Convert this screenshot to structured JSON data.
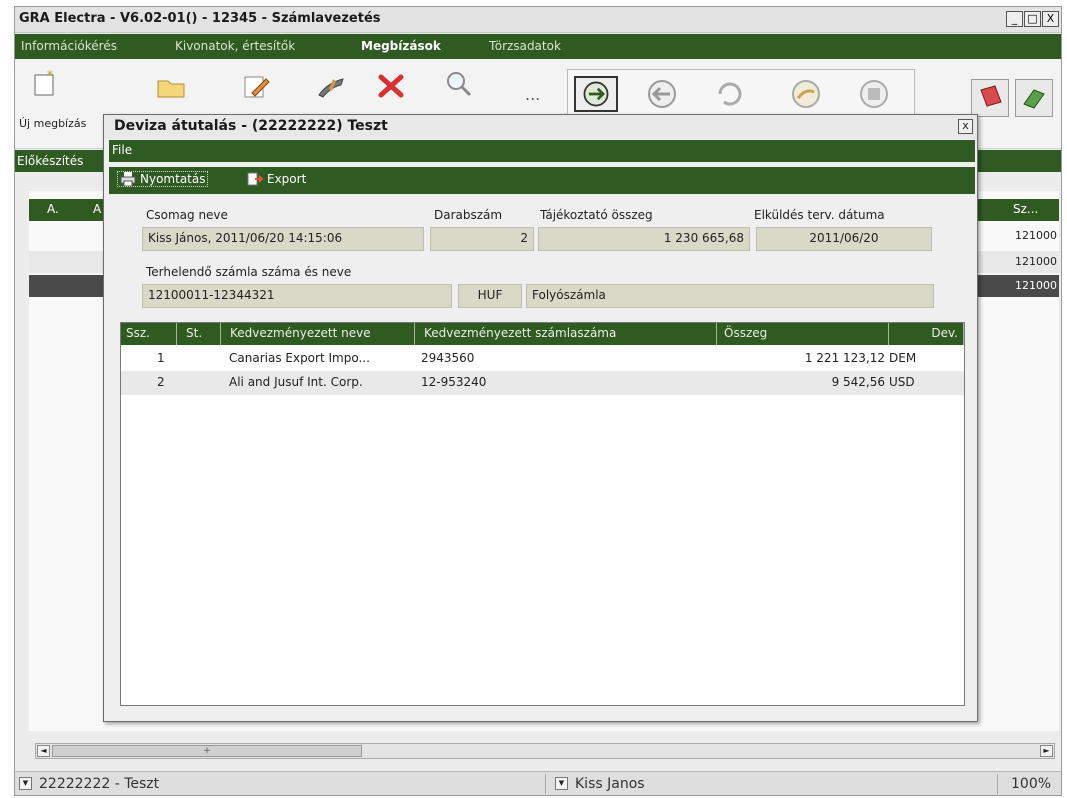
{
  "window": {
    "title": "GRA Electra - V6.02-01() - 12345 - Számlavezetés",
    "controls": [
      "_",
      "□",
      "X"
    ]
  },
  "menu": {
    "items": [
      "Információkérés",
      "Kivonatok, értesítők",
      "Megbízások",
      "Törzsadatok"
    ],
    "active": "Megbízások"
  },
  "toolbar": {
    "new_order_label": "Új megbízás",
    "icons": [
      "new-document-icon",
      "folder-icon",
      "edit-icon",
      "sign-icon",
      "delete-icon",
      "search-icon",
      "more-icon"
    ],
    "more_label": "...",
    "group_icons": [
      "send-icon",
      "retrieve-icon",
      "refresh-icon",
      "status-icon",
      "archive-icon"
    ]
  },
  "status_strip": {
    "label": "Előkészítés"
  },
  "background_grid": {
    "headers": [
      "A.",
      "A",
      "Sz..."
    ],
    "cells": [
      "121000",
      "121000",
      "121000"
    ]
  },
  "dialog": {
    "title": "Deviza átutalás  - (22222222) Teszt",
    "close": "x",
    "menu_file": "File",
    "print_label": "Nyomtatás",
    "export_label": "Export",
    "fields": {
      "package_name_label": "Csomag neve",
      "package_name": "Kiss János, 2011/06/20 14:15:06",
      "count_label": "Darabszám",
      "count": "2",
      "info_amount_label": "Tájékoztató összeg",
      "info_amount": "1 230 665,68",
      "send_date_label": "Elküldés terv. dátuma",
      "send_date": "2011/06/20",
      "debit_account_label": "Terhelendő számla száma és neve",
      "debit_account": "12100011-12344321",
      "currency": "HUF",
      "account_name": "Folyószámla"
    },
    "table": {
      "columns": [
        "Ssz.",
        "St.",
        "Kedvezményezett neve",
        "Kedvezményezett számlaszáma",
        "Összeg",
        "Dev."
      ],
      "rows": [
        {
          "ssz": "1",
          "st": "",
          "name": "Canarias Export Impo...",
          "account": "2943560",
          "amount": "1 221 123,12",
          "currency": "DEM"
        },
        {
          "ssz": "2",
          "st": "",
          "name": "Ali and Jusuf Int. Corp.",
          "account": "12-953240",
          "amount": "9 542,56",
          "currency": "USD"
        }
      ]
    }
  },
  "scrollbar": {
    "left_arrow": "◄",
    "right_arrow": "►",
    "thumb": "+"
  },
  "bottom_bar": {
    "client": "22222222 - Teszt",
    "user": "Kiss Janos",
    "zoom": "100%"
  },
  "colors": {
    "accent_green": "#2f5a22",
    "field_bg": "#d9d9c8",
    "selected_row": "#4a4a4a"
  }
}
